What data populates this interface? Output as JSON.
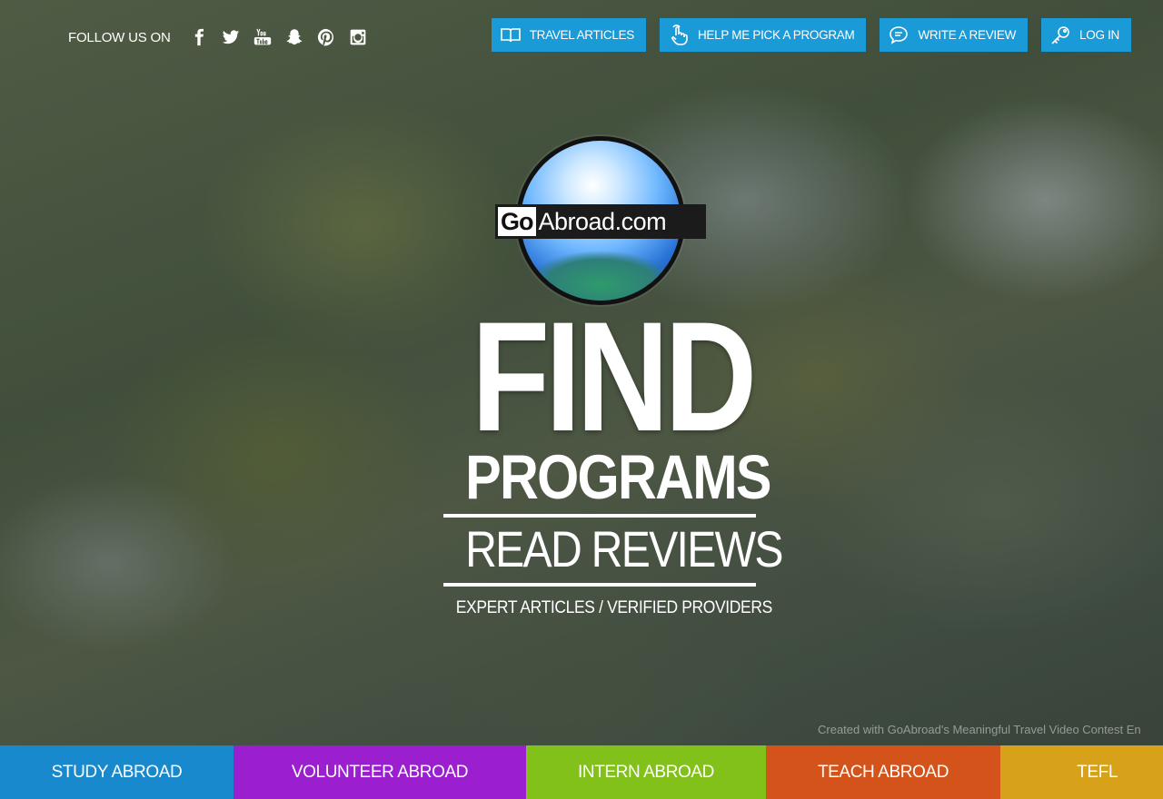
{
  "follow": {
    "label": "FOLLOW US ON",
    "icons": [
      "facebook-icon",
      "twitter-icon",
      "youtube-icon",
      "snapchat-icon",
      "pinterest-icon",
      "instagram-icon"
    ]
  },
  "nav": {
    "travel_articles": "TRAVEL ARTICLES",
    "help_pick": "HELP ME PICK A PROGRAM",
    "write_review": "WRITE A REVIEW",
    "login": "LOG IN",
    "accent": "#1a9ad6"
  },
  "logo": {
    "go": "Go",
    "rest": "Abroad.com"
  },
  "hero": {
    "find": "FIND",
    "programs": "PROGRAMS",
    "reviews": "READ REVIEWS",
    "sub": "EXPERT ARTICLES / VERIFIED PROVIDERS"
  },
  "credit": "Created with GoAbroad's Meaningful Travel Video Contest En",
  "categories": [
    {
      "label": "STUDY ABROAD",
      "color": "#1889cc"
    },
    {
      "label": "VOLUNTEER ABROAD",
      "color": "#9b1fcf"
    },
    {
      "label": "INTERN ABROAD",
      "color": "#82c01a"
    },
    {
      "label": "TEACH ABROAD",
      "color": "#d3531a"
    },
    {
      "label": "TEFL",
      "color": "#d8a11a"
    }
  ]
}
